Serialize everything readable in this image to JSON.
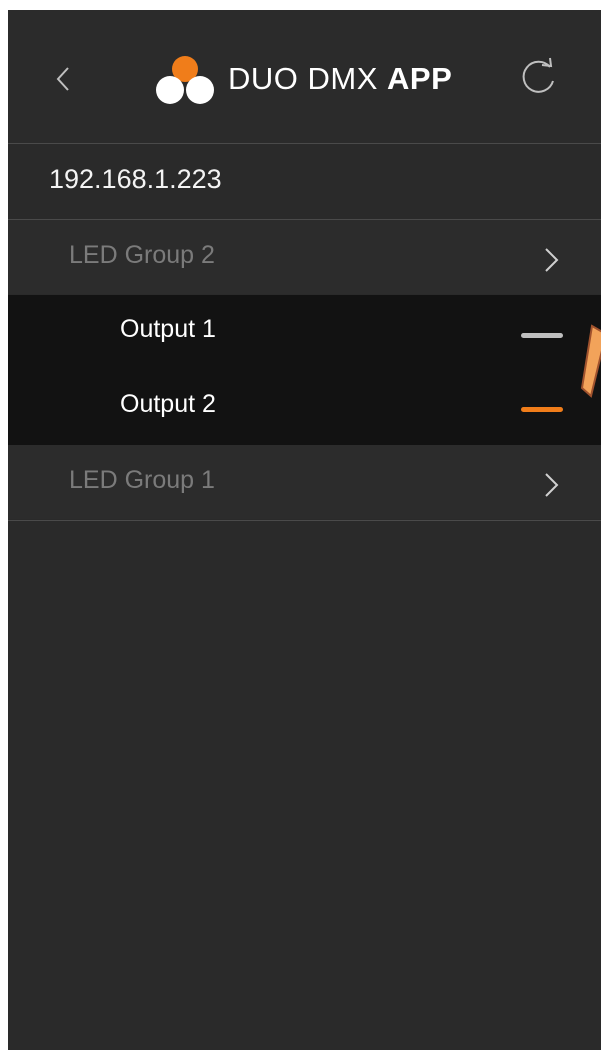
{
  "header": {
    "title_normal": "DUO DMX ",
    "title_bold": "APP",
    "back_icon": "chevron-left-icon",
    "refresh_icon": "refresh-icon"
  },
  "device": {
    "ip": "192.168.1.223"
  },
  "groups": [
    {
      "label": "LED Group 2",
      "expanded": true,
      "outputs": [
        {
          "label": "Output 1",
          "indicator_color": "#bfbfbf",
          "selected": false
        },
        {
          "label": "Output 2",
          "indicator_color": "#f07d1a",
          "selected": true
        }
      ]
    },
    {
      "label": "LED Group 1",
      "expanded": false
    }
  ],
  "colors": {
    "accent": "#f07d1a",
    "background": "#2a2a2a",
    "expanded_background": "#121212"
  }
}
